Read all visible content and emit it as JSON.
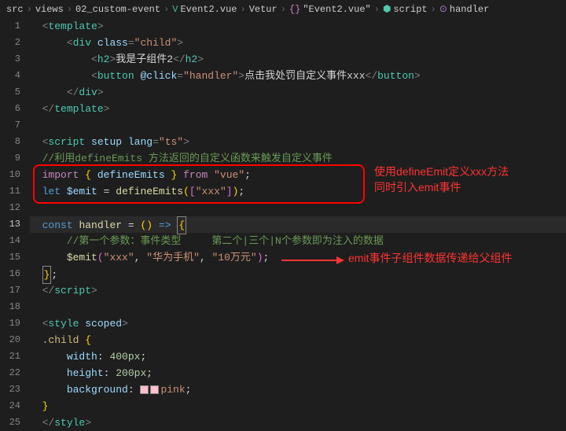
{
  "breadcrumb": {
    "p1": "src",
    "p2": "views",
    "p3": "02_custom-event",
    "p4": "Event2.vue",
    "p5": "Vetur",
    "p6": "\"Event2.vue\"",
    "p7": "script",
    "p8": "handler"
  },
  "gutter": {
    "l1": "1",
    "l2": "2",
    "l3": "3",
    "l4": "4",
    "l5": "5",
    "l6": "6",
    "l7": "7",
    "l8": "8",
    "l9": "9",
    "l10": "10",
    "l11": "11",
    "l12": "12",
    "l13": "13",
    "l14": "14",
    "l15": "15",
    "l16": "16",
    "l17": "17",
    "l18": "18",
    "l19": "19",
    "l20": "20",
    "l21": "21",
    "l22": "22",
    "l23": "23",
    "l24": "24",
    "l25": "25"
  },
  "code": {
    "l1": {
      "t1": "<",
      "t2": "template",
      "t3": ">"
    },
    "l2": {
      "t1": "<",
      "t2": "div",
      "t3": "class",
      "t4": "=",
      "t5": "\"child\"",
      "t6": ">"
    },
    "l3": {
      "t1": "<",
      "t2": "h2",
      "t3": ">",
      "t4": "我是子组件2",
      "t5": "</",
      "t6": "h2",
      "t7": ">"
    },
    "l4": {
      "t1": "<",
      "t2": "button",
      "t3": "@click",
      "t4": "=",
      "t5": "\"handler\"",
      "t6": ">",
      "t7": "点击我处罚自定义事件xxx",
      "t8": "</",
      "t9": "button",
      "t10": ">"
    },
    "l5": {
      "t1": "</",
      "t2": "div",
      "t3": ">"
    },
    "l6": {
      "t1": "</",
      "t2": "template",
      "t3": ">"
    },
    "l8": {
      "t1": "<",
      "t2": "script",
      "t3": "setup",
      "t4": "lang",
      "t5": "=",
      "t6": "\"ts\"",
      "t7": ">"
    },
    "l9": {
      "t1": "//利用defineEmits 方法返回的自定义函数来触发自定义事件"
    },
    "l10": {
      "t1": "import",
      "t2": "{ ",
      "t3": "defineEmits",
      "t4": " }",
      "t5": "from",
      "t6": "\"vue\"",
      "t7": ";"
    },
    "l11": {
      "t1": "let",
      "t2": "$emit",
      "t3": "=",
      "t4": "defineEmits",
      "t5": "(",
      "t6": "[",
      "t7": "\"xxx\"",
      "t8": "]",
      "t9": ")",
      "t10": ";"
    },
    "l13": {
      "t1": "const",
      "t2": "handler",
      "t3": "=",
      "t4": "()",
      "t5": "=>",
      "t6": "{"
    },
    "l14": {
      "t1": "//第一个参数：事件类型     第二个|三个|N个参数即为注入的数据"
    },
    "l15": {
      "t1": "$emit",
      "t2": "(",
      "t3": "\"xxx\"",
      "t4": ", ",
      "t5": "\"华为手机\"",
      "t6": ", ",
      "t7": "\"10万元\"",
      "t8": ")",
      "t9": ";"
    },
    "l16": {
      "t1": "}",
      "t2": ";"
    },
    "l17": {
      "t1": "</",
      "t2": "script",
      "t3": ">"
    },
    "l19": {
      "t1": "<",
      "t2": "style",
      "t3": "scoped",
      "t4": ">"
    },
    "l20": {
      "t1": ".child",
      "t2": "{"
    },
    "l21": {
      "t1": "width",
      "t2": ": ",
      "t3": "400px",
      "t4": ";"
    },
    "l22": {
      "t1": "height",
      "t2": ": ",
      "t3": "200px",
      "t4": ";"
    },
    "l23": {
      "t1": "background",
      "t2": ": ",
      "t3": "pink",
      "t4": ";"
    },
    "l24": {
      "t1": "}"
    },
    "l25": {
      "t1": "</",
      "t2": "style",
      "t3": ">"
    }
  },
  "annotations": {
    "a1_line1": "使用defineEmit定义xxx方法",
    "a1_line2": "同时引入emit事件",
    "a2": "emit事件子组件数据传递给父组件"
  }
}
